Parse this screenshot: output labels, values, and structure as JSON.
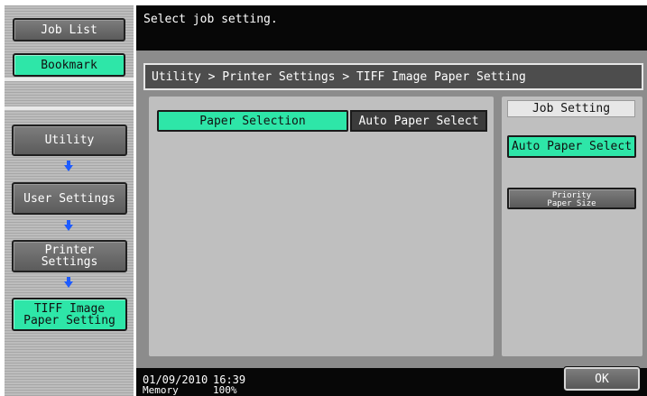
{
  "sidebar": {
    "job_list": "Job List",
    "bookmark": "Bookmark",
    "utility": "Utility",
    "user_settings": "User Settings",
    "printer_settings": "Printer Settings",
    "tiff_line1": "TIFF Image",
    "tiff_line2": "Paper Setting"
  },
  "message": "Select job setting.",
  "breadcrumb": "Utility > Printer Settings > TIFF Image Paper Setting",
  "paper": {
    "label": "Paper Selection",
    "value": "Auto Paper Select"
  },
  "job_setting": {
    "title": "Job Setting",
    "auto_button": "Auto Paper Select",
    "priority_line1": "Priority",
    "priority_line2": "Paper Size"
  },
  "status": {
    "date": "01/09/2010",
    "time": "16:39",
    "memory_label": "Memory",
    "memory_value": "100%"
  },
  "ok_button": "OK",
  "colors": {
    "accent_green": "#2ee6a8",
    "arrow_blue": "#1e5bff"
  },
  "icons": [
    "down-arrow-icon"
  ]
}
